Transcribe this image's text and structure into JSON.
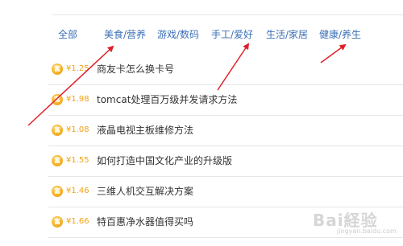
{
  "tabs": [
    {
      "label": "全部"
    },
    {
      "label": "美食/营养"
    },
    {
      "label": "游戏/数码"
    },
    {
      "label": "手工/爱好"
    },
    {
      "label": "生活/家居"
    },
    {
      "label": "健康/养生"
    }
  ],
  "items": [
    {
      "price": "¥1.25",
      "title": "商友卡怎么换卡号"
    },
    {
      "price": "¥1.98",
      "title": "tomcat处理百万级并发请求方法"
    },
    {
      "price": "¥1.08",
      "title": "液晶电视主板维修方法"
    },
    {
      "price": "¥1.55",
      "title": "如何打造中国文化产业的升级版"
    },
    {
      "price": "¥1.46",
      "title": "三维人机交互解决方案"
    },
    {
      "price": "¥1.66",
      "title": "特百惠净水器值得买吗"
    }
  ],
  "coin_glyph": "富",
  "watermark": {
    "text": "Bai経验",
    "sub": "jingyan.baidu.com"
  },
  "colors": {
    "tab": "#3b6fb6",
    "price": "#f0a31a",
    "arrow": "#e0202a",
    "divider": "#e6e6e6"
  }
}
